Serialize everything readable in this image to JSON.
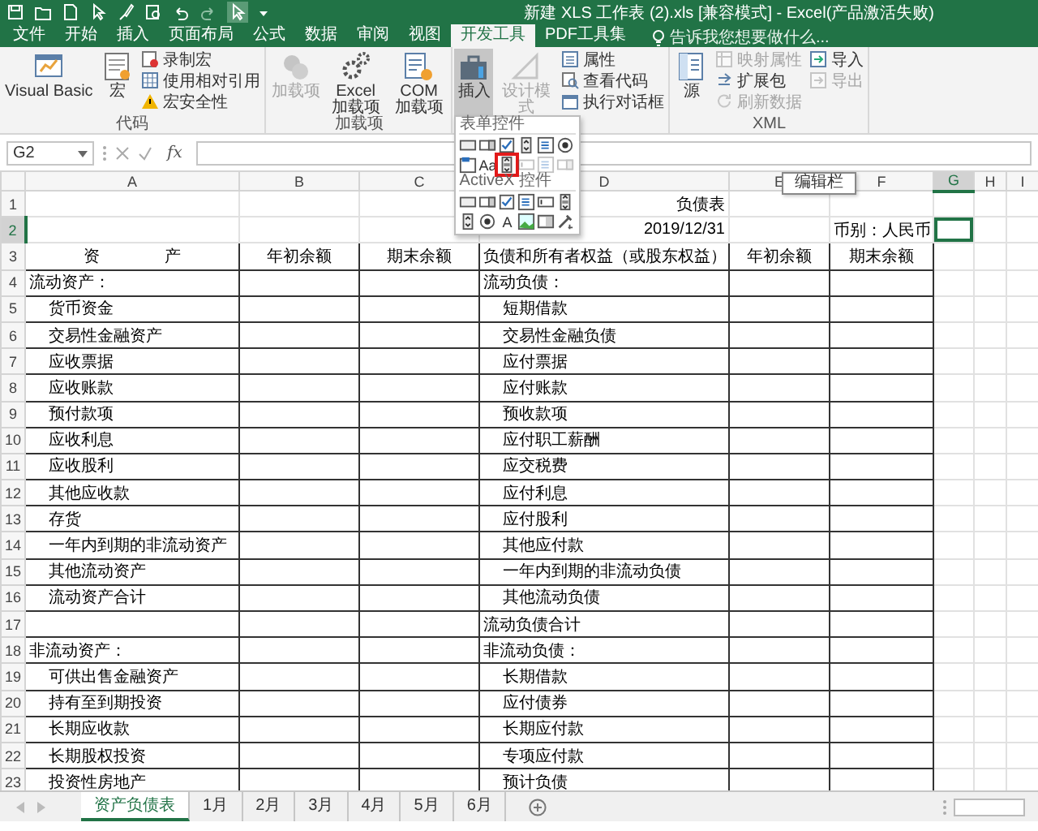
{
  "window": {
    "title": "新建 XLS 工作表 (2).xls  [兼容模式] - Excel(产品激活失败)"
  },
  "ribbon_tabs": [
    {
      "label": "文件",
      "selected": false
    },
    {
      "label": "开始",
      "selected": false
    },
    {
      "label": "插入",
      "selected": false
    },
    {
      "label": "页面布局",
      "selected": false
    },
    {
      "label": "公式",
      "selected": false
    },
    {
      "label": "数据",
      "selected": false
    },
    {
      "label": "审阅",
      "selected": false
    },
    {
      "label": "视图",
      "selected": false
    },
    {
      "label": "开发工具",
      "selected": true
    },
    {
      "label": "PDF工具集",
      "selected": false
    }
  ],
  "tell_me": {
    "placeholder": "告诉我您想要做什么..."
  },
  "ribbon_groups": [
    {
      "label": "代码",
      "buttons": [
        {
          "label": "Visual Basic",
          "disabled": false,
          "pressed": false
        },
        {
          "label": "宏",
          "disabled": false,
          "pressed": false
        }
      ],
      "small_buttons": [
        {
          "label": "录制宏",
          "disabled": false,
          "pressed": false
        },
        {
          "label": "使用相对引用",
          "disabled": false,
          "pressed": false
        },
        {
          "label": "宏安全性",
          "disabled": false,
          "pressed": false
        }
      ]
    },
    {
      "label": "加载项",
      "buttons": [
        {
          "label": "加载项",
          "disabled": true,
          "pressed": false
        },
        {
          "label": "Excel 加载项",
          "disabled": false,
          "pressed": false
        },
        {
          "label": "COM 加载项",
          "disabled": false,
          "pressed": false
        }
      ]
    },
    {
      "buttons": [
        {
          "label": "插入",
          "disabled": false,
          "pressed": true
        },
        {
          "label": "设计模式",
          "disabled": true,
          "pressed": false
        }
      ],
      "small_buttons": [
        {
          "label": "属性",
          "disabled": false,
          "pressed": false
        },
        {
          "label": "查看代码",
          "disabled": false,
          "pressed": false
        },
        {
          "label": "执行对话框",
          "disabled": false,
          "pressed": false
        }
      ]
    },
    {
      "label": "XML",
      "buttons": [
        {
          "label": "源",
          "disabled": false,
          "pressed": false
        }
      ],
      "small_buttons": [
        {
          "label": "映射属性",
          "disabled": true,
          "pressed": false
        },
        {
          "label": "扩展包",
          "disabled": false,
          "pressed": false
        },
        {
          "label": "刷新数据",
          "disabled": true,
          "pressed": false
        },
        {
          "label": "导入",
          "disabled": false,
          "pressed": false
        },
        {
          "label": "导出",
          "disabled": true,
          "pressed": false
        }
      ]
    }
  ],
  "insert_menu": {
    "sections": [
      {
        "title": "表单控件",
        "controls": [
          {
            "kind": "button",
            "disabled": false,
            "highlighted": false
          },
          {
            "kind": "combo",
            "disabled": false,
            "highlighted": false
          },
          {
            "kind": "checkbox",
            "disabled": false,
            "highlighted": false
          },
          {
            "kind": "spin",
            "disabled": false,
            "highlighted": false
          },
          {
            "kind": "listbox",
            "disabled": false,
            "highlighted": false
          },
          {
            "kind": "option",
            "disabled": false,
            "highlighted": false
          },
          {
            "kind": "group",
            "disabled": false,
            "highlighted": false
          },
          {
            "kind": "label",
            "glyph": "Aa",
            "disabled": false,
            "highlighted": false
          },
          {
            "kind": "scrollbar",
            "disabled": false,
            "highlighted": true
          },
          {
            "kind": "textbox",
            "disabled": true,
            "highlighted": false
          },
          {
            "kind": "listbox",
            "disabled": true,
            "highlighted": false
          },
          {
            "kind": "combo",
            "disabled": true,
            "highlighted": false
          }
        ]
      },
      {
        "title": "ActiveX 控件",
        "controls": [
          {
            "kind": "button",
            "disabled": false,
            "highlighted": false
          },
          {
            "kind": "combo",
            "disabled": false,
            "highlighted": false
          },
          {
            "kind": "checkbox",
            "disabled": false,
            "highlighted": false
          },
          {
            "kind": "listbox",
            "disabled": false,
            "highlighted": false
          },
          {
            "kind": "textbox",
            "disabled": false,
            "highlighted": false
          },
          {
            "kind": "scrollbar",
            "disabled": false,
            "highlighted": false
          },
          {
            "kind": "spin",
            "disabled": false,
            "highlighted": false
          },
          {
            "kind": "option",
            "disabled": false,
            "highlighted": false
          },
          {
            "kind": "label",
            "glyph": "A",
            "disabled": false,
            "highlighted": false
          },
          {
            "kind": "image",
            "disabled": false,
            "highlighted": false
          },
          {
            "kind": "toggle",
            "disabled": false,
            "highlighted": false
          },
          {
            "kind": "more",
            "disabled": false,
            "highlighted": false
          }
        ]
      }
    ]
  },
  "formula_bar": {
    "name_box": "G2",
    "function_button": "fx"
  },
  "tooltip": "编辑栏",
  "columns": [
    {
      "label": "A",
      "selected": false
    },
    {
      "label": "B",
      "selected": false
    },
    {
      "label": "C",
      "selected": false
    },
    {
      "label": "D",
      "selected": false
    },
    {
      "label": "E",
      "selected": false
    },
    {
      "label": "F",
      "selected": false
    },
    {
      "label": "G",
      "selected": true
    },
    {
      "label": "H",
      "selected": false
    },
    {
      "label": "I",
      "selected": false
    }
  ],
  "rows": [
    {
      "number": "1",
      "kind": "title",
      "selected": false,
      "d": {
        "text": "负债表"
      }
    },
    {
      "number": "2",
      "kind": "info",
      "selected": true,
      "d": {
        "text": "2019/12/31"
      },
      "f": {
        "text": "币别：人民币"
      }
    },
    {
      "number": "3",
      "kind": "header",
      "selected": false,
      "a": {
        "text": "资　　　　产",
        "indent": false
      },
      "b": {
        "text": "年初余额",
        "indent": false
      },
      "c": {
        "text": "期末余额",
        "indent": false
      },
      "d": {
        "text": "负债和所有者权益（或股东权益）",
        "indent": false
      },
      "e": {
        "text": "年初余额",
        "indent": false
      },
      "f": {
        "text": "期末余额",
        "indent": false
      }
    },
    {
      "number": "4",
      "kind": "body",
      "selected": false,
      "a": {
        "text": "流动资产：",
        "indent": false
      },
      "d": {
        "text": "流动负债：",
        "indent": false
      }
    },
    {
      "number": "5",
      "kind": "body",
      "selected": false,
      "a": {
        "text": "货币资金",
        "indent": true
      },
      "d": {
        "text": "短期借款",
        "indent": true
      }
    },
    {
      "number": "6",
      "kind": "body",
      "selected": false,
      "a": {
        "text": "交易性金融资产",
        "indent": true
      },
      "d": {
        "text": "交易性金融负债",
        "indent": true
      }
    },
    {
      "number": "7",
      "kind": "body",
      "selected": false,
      "a": {
        "text": "应收票据",
        "indent": true
      },
      "d": {
        "text": "应付票据",
        "indent": true
      }
    },
    {
      "number": "8",
      "kind": "body",
      "selected": false,
      "a": {
        "text": "应收账款",
        "indent": true
      },
      "d": {
        "text": "应付账款",
        "indent": true
      }
    },
    {
      "number": "9",
      "kind": "body",
      "selected": false,
      "a": {
        "text": "预付款项",
        "indent": true
      },
      "d": {
        "text": "预收款项",
        "indent": true
      }
    },
    {
      "number": "10",
      "kind": "body",
      "selected": false,
      "a": {
        "text": "应收利息",
        "indent": true
      },
      "d": {
        "text": "应付职工薪酬",
        "indent": true
      }
    },
    {
      "number": "11",
      "kind": "body",
      "selected": false,
      "a": {
        "text": "应收股利",
        "indent": true
      },
      "d": {
        "text": "应交税费",
        "indent": true
      }
    },
    {
      "number": "12",
      "kind": "body",
      "selected": false,
      "a": {
        "text": "其他应收款",
        "indent": true
      },
      "d": {
        "text": "应付利息",
        "indent": true
      }
    },
    {
      "number": "13",
      "kind": "body",
      "selected": false,
      "a": {
        "text": "存货",
        "indent": true
      },
      "d": {
        "text": "应付股利",
        "indent": true
      }
    },
    {
      "number": "14",
      "kind": "body",
      "selected": false,
      "a": {
        "text": "一年内到期的非流动资产",
        "indent": true
      },
      "d": {
        "text": "其他应付款",
        "indent": true
      }
    },
    {
      "number": "15",
      "kind": "body",
      "selected": false,
      "a": {
        "text": "其他流动资产",
        "indent": true
      },
      "d": {
        "text": "一年内到期的非流动负债",
        "indent": true
      }
    },
    {
      "number": "16",
      "kind": "body",
      "selected": false,
      "a": {
        "text": "流动资产合计",
        "indent": true
      },
      "d": {
        "text": "其他流动负债",
        "indent": true
      }
    },
    {
      "number": "17",
      "kind": "body",
      "selected": false,
      "d": {
        "text": "流动负债合计",
        "indent": false
      }
    },
    {
      "number": "18",
      "kind": "body",
      "selected": false,
      "a": {
        "text": "非流动资产：",
        "indent": false
      },
      "d": {
        "text": "非流动负债：",
        "indent": false
      }
    },
    {
      "number": "19",
      "kind": "body",
      "selected": false,
      "a": {
        "text": "可供出售金融资产",
        "indent": true
      },
      "d": {
        "text": "长期借款",
        "indent": true
      }
    },
    {
      "number": "20",
      "kind": "body",
      "selected": false,
      "a": {
        "text": "持有至到期投资",
        "indent": true
      },
      "d": {
        "text": "应付债券",
        "indent": true
      }
    },
    {
      "number": "21",
      "kind": "body",
      "selected": false,
      "a": {
        "text": "长期应收款",
        "indent": true
      },
      "d": {
        "text": "长期应付款",
        "indent": true
      }
    },
    {
      "number": "22",
      "kind": "body",
      "selected": false,
      "a": {
        "text": "长期股权投资",
        "indent": true
      },
      "d": {
        "text": "专项应付款",
        "indent": true
      }
    },
    {
      "number": "23",
      "kind": "body",
      "selected": false,
      "a": {
        "text": "投资性房地产",
        "indent": true
      },
      "d": {
        "text": "预计负债",
        "indent": true
      }
    }
  ],
  "sheet_tabs": [
    {
      "label": "资产负债表",
      "selected": true
    },
    {
      "label": "1月",
      "selected": false
    },
    {
      "label": "2月",
      "selected": false
    },
    {
      "label": "3月",
      "selected": false
    },
    {
      "label": "4月",
      "selected": false
    },
    {
      "label": "5月",
      "selected": false
    },
    {
      "label": "6月",
      "selected": false
    }
  ]
}
